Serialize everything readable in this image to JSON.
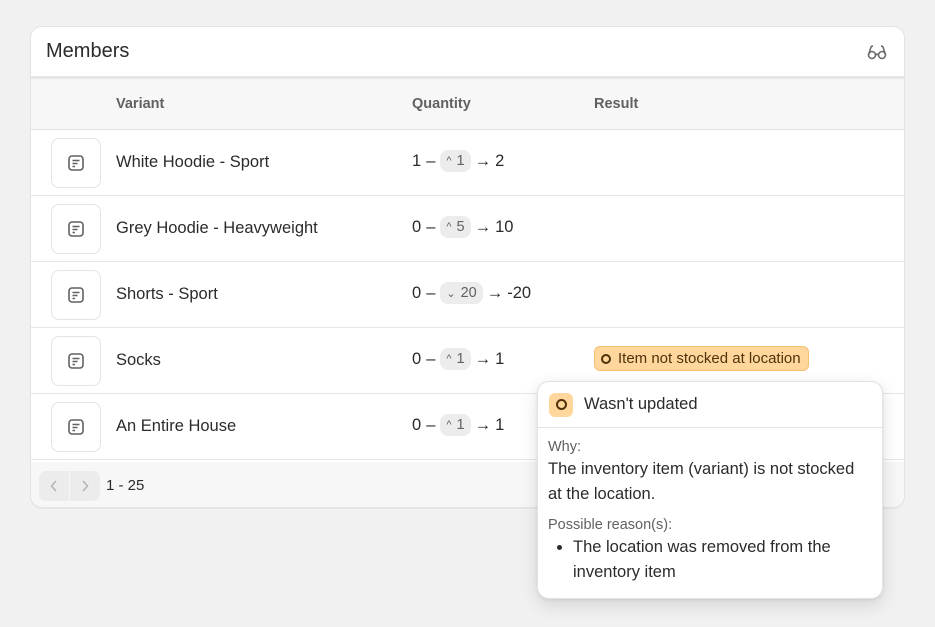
{
  "card": {
    "title": "Members",
    "header_icon": "glasses-icon"
  },
  "table": {
    "columns": [
      "Variant",
      "Quantity",
      "Result"
    ],
    "rows": [
      {
        "variant": "White Hoodie - Sport",
        "from": "1",
        "dash": "–",
        "direction": "up",
        "delta": "1",
        "arrow": "→",
        "to": "2",
        "result": ""
      },
      {
        "variant": "Grey Hoodie - Heavyweight",
        "from": "0",
        "dash": "–",
        "direction": "up",
        "delta": "5",
        "arrow": "→",
        "to": "10",
        "result": ""
      },
      {
        "variant": "Shorts - Sport",
        "from": "0",
        "dash": "–",
        "direction": "down",
        "delta": "20",
        "arrow": "→",
        "to": "-20",
        "result": ""
      },
      {
        "variant": "Socks",
        "from": "0",
        "dash": "–",
        "direction": "up",
        "delta": "1",
        "arrow": "→",
        "to": "1",
        "result": "Item not stocked at location"
      },
      {
        "variant": "An Entire House",
        "from": "0",
        "dash": "–",
        "direction": "up",
        "delta": "1",
        "arrow": "→",
        "to": "1",
        "result": ""
      }
    ]
  },
  "pagination": {
    "range": "1 - 25",
    "prev_icon": "chevron-left-icon",
    "next_icon": "chevron-right-icon"
  },
  "popover": {
    "title": "Wasn't updated",
    "why_label": "Why:",
    "why_text": "The inventory item (variant) is not stocked at the location.",
    "reasons_label": "Possible reason(s):",
    "reasons": [
      "The location was removed from the inventory item"
    ]
  },
  "colors": {
    "warning_bg": "#ffd79d",
    "warning_text": "#4f3208",
    "page_bg": "#f1f1f2"
  }
}
